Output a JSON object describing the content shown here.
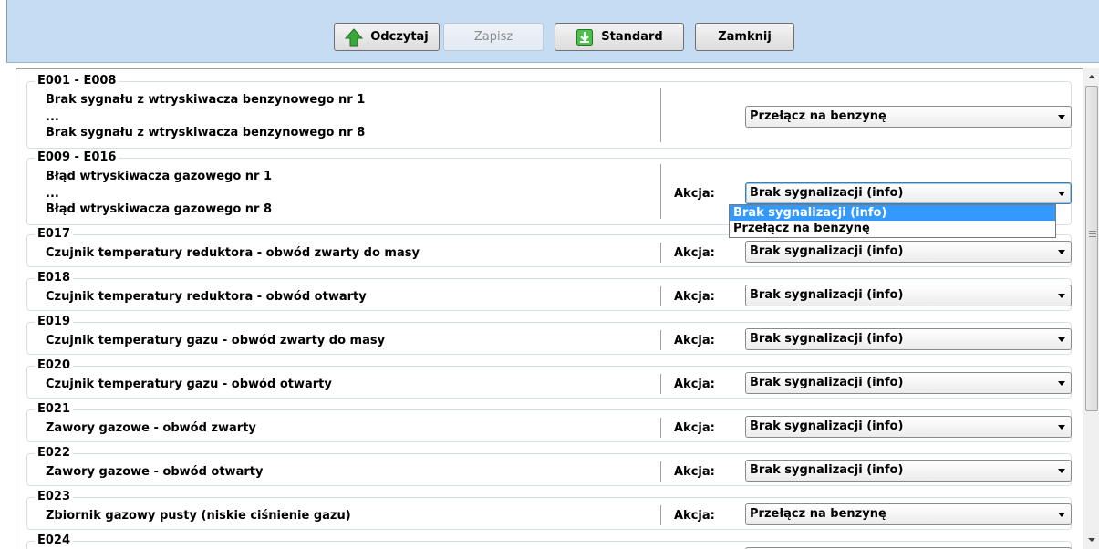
{
  "toolbar": {
    "read_label": "Odczytaj",
    "save_label": "Zapisz",
    "standard_label": "Standard",
    "close_label": "Zamknij"
  },
  "action_label": "Akcja:",
  "groups": [
    {
      "code": "E001 - E008",
      "lines": [
        "Brak sygnału z wtryskiwacza benzynowego nr 1",
        "...",
        "Brak sygnału z wtryskiwacza benzynowego nr 8"
      ],
      "show_action_label": false,
      "action": "Przełącz na benzynę"
    },
    {
      "code": "E009 - E016",
      "lines": [
        "Błąd wtryskiwacza gazowego nr 1",
        "...",
        "Błąd wtryskiwacza gazowego nr 8"
      ],
      "show_action_label": true,
      "action": "Brak sygnalizacji (info)"
    },
    {
      "code": "E017",
      "lines": [
        "Czujnik temperatury reduktora - obwód zwarty do masy"
      ],
      "show_action_label": true,
      "action": "Brak sygnalizacji (info)"
    },
    {
      "code": "E018",
      "lines": [
        "Czujnik temperatury reduktora - obwód otwarty"
      ],
      "show_action_label": true,
      "action": "Brak sygnalizacji (info)"
    },
    {
      "code": "E019",
      "lines": [
        "Czujnik temperatury gazu - obwód zwarty do masy"
      ],
      "show_action_label": true,
      "action": "Brak sygnalizacji (info)"
    },
    {
      "code": "E020",
      "lines": [
        "Czujnik temperatury gazu - obwód otwarty"
      ],
      "show_action_label": true,
      "action": "Brak sygnalizacji (info)"
    },
    {
      "code": "E021",
      "lines": [
        "Zawory gazowe - obwód zwarty"
      ],
      "show_action_label": true,
      "action": "Brak sygnalizacji (info)"
    },
    {
      "code": "E022",
      "lines": [
        "Zawory gazowe - obwód otwarty"
      ],
      "show_action_label": true,
      "action": "Brak sygnalizacji (info)"
    },
    {
      "code": "E023",
      "lines": [
        "Zbiornik gazowy pusty (niskie ciśnienie gazu)"
      ],
      "show_action_label": true,
      "action": "Przełącz na benzynę"
    },
    {
      "code": "E024",
      "lines": [],
      "show_action_label": false,
      "action": ""
    }
  ],
  "dropdown": {
    "options": [
      "Brak sygnalizacji (info)",
      "Przełącz na benzynę"
    ],
    "selected_index": 0
  },
  "colors": {
    "toolbar_bg": "#c6dcf3",
    "selection": "#3399ff",
    "icon_green": "#3aa83a"
  },
  "icons": [
    "arrow-up-icon",
    "download-icon",
    "scroll-up-arrow-icon",
    "scroll-down-arrow-icon"
  ]
}
